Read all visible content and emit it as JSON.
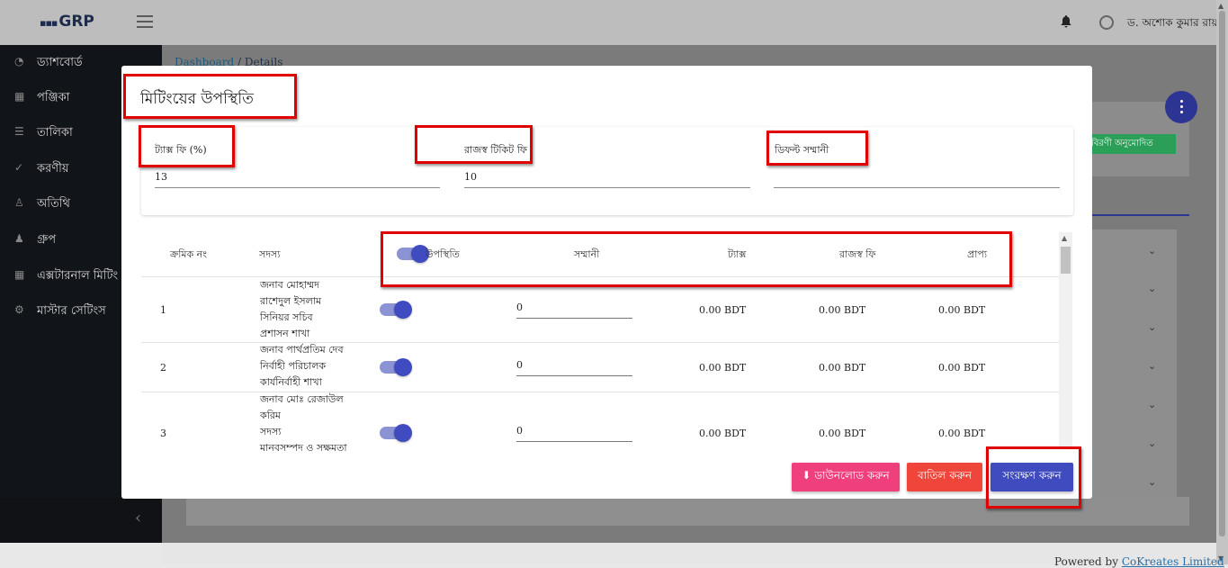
{
  "topbar": {
    "logo": "GRP",
    "user_name": "ড. অশোক কুমার রায়"
  },
  "sidebar": {
    "items": [
      {
        "label": "ড্যাশবোর্ড",
        "icon": "dashboard-icon"
      },
      {
        "label": "পঞ্জিকা",
        "icon": "calendar-icon"
      },
      {
        "label": "তালিকা",
        "icon": "list-icon"
      },
      {
        "label": "করণীয়",
        "icon": "check-circle-icon"
      },
      {
        "label": "অতিথি",
        "icon": "user-icon"
      },
      {
        "label": "গ্রুপ",
        "icon": "group-icon"
      },
      {
        "label": "এক্সটারনাল মিটিং",
        "icon": "calendar-grid-icon"
      },
      {
        "label": "মাস্টার সেটিংস",
        "icon": "gear-icon"
      }
    ]
  },
  "breadcrumb": {
    "home": "Dashboard",
    "separator": "/",
    "current": "Details"
  },
  "background": {
    "status_badge": "বিরণী অনুমোদিত"
  },
  "modal": {
    "title": "মিটিংয়ের উপস্থিতি",
    "fields": {
      "tax_fee_label": "ট্যাক্স ফি (%)",
      "tax_fee_value": "13",
      "revenue_ticket_fee_label": "রাজস্ব টিকিট ফি",
      "revenue_ticket_fee_value": "10",
      "default_honorarium_label": "ডিফল্ট সম্মানী",
      "default_honorarium_value": ""
    },
    "table": {
      "headers": {
        "serial": "ক্রমিক নং",
        "member": "সদস্য",
        "attendance": "উপস্থিতি",
        "honorarium": "সম্মানী",
        "tax": "ট্যাক্স",
        "revenue_fee": "রাজস্ব ফি",
        "receivable": "প্রাপ্য"
      },
      "rows": [
        {
          "serial": "1",
          "member_lines": [
            "জনাব মোহাম্মদ",
            "রাশেদুল ইসলাম",
            "সিনিয়র সচিব",
            "প্রশাসন শাখা"
          ],
          "attendance": true,
          "honorarium": "0",
          "tax": "0.00 BDT",
          "revenue_fee": "0.00 BDT",
          "receivable": "0.00 BDT"
        },
        {
          "serial": "2",
          "member_lines": [
            "জনাব পার্থপ্রতিম দেব",
            "নির্বাহী পরিচালক",
            "কার্যনির্বাহী শাখা"
          ],
          "attendance": true,
          "honorarium": "0",
          "tax": "0.00 BDT",
          "revenue_fee": "0.00 BDT",
          "receivable": "0.00 BDT"
        },
        {
          "serial": "3",
          "member_lines": [
            "জনাব মোঃ রেজাউল",
            "করিম",
            "সদস্য",
            "মানবসম্পদ ও সক্ষমতা"
          ],
          "attendance": true,
          "honorarium": "0",
          "tax": "0.00 BDT",
          "revenue_fee": "0.00 BDT",
          "receivable": "0.00 BDT"
        }
      ]
    },
    "buttons": {
      "download": "ডাউনলোড করুন",
      "cancel": "বাতিল করুন",
      "save": "সংরক্ষণ করুন"
    }
  },
  "footer": {
    "powered_by": "Powered by",
    "company": "CoKreates Limited"
  },
  "colors": {
    "sidebar_bg": "#111418",
    "primary": "#3f4bbf",
    "download_btn": "#ef3f7c",
    "cancel_btn": "#f0453a",
    "highlight_box": "#e10000"
  }
}
